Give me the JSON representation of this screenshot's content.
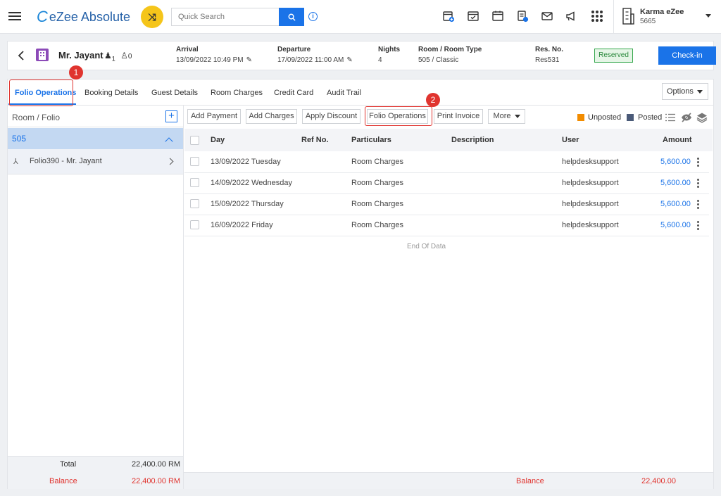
{
  "topbar": {
    "logo_text": "eZee Absolute",
    "search_placeholder": "Quick Search",
    "info_glyph": "i",
    "user_name": "Karma eZee",
    "user_sub": "5665",
    "icons": [
      "calendar-add-icon",
      "calendar-check-icon",
      "calendar-icon",
      "invoice-icon",
      "mail-icon",
      "megaphone-icon",
      "apps-grid-icon",
      "building-icon"
    ]
  },
  "reservation": {
    "guest_name": "Mr. Jayant",
    "adults": "1",
    "children": "0",
    "arrival_label": "Arrival",
    "arrival_value": "13/09/2022 10:49 PM",
    "departure_label": "Departure",
    "departure_value": "17/09/2022 11:00 AM",
    "nights_label": "Nights",
    "nights_value": "4",
    "room_label": "Room / Room Type",
    "room_value": "505 / Classic",
    "resno_label": "Res. No.",
    "resno_value": "Res531",
    "status_badge": "Reserved",
    "checkin_label": "Check-in"
  },
  "tabs": [
    {
      "label": "Folio Operations",
      "active": true
    },
    {
      "label": "Booking Details",
      "active": false
    },
    {
      "label": "Guest Details",
      "active": false
    },
    {
      "label": "Room Charges",
      "active": false
    },
    {
      "label": "Credit Card",
      "active": false
    },
    {
      "label": "Audit Trail",
      "active": false
    }
  ],
  "options_label": "Options",
  "steps": [
    "1",
    "2"
  ],
  "left_panel": {
    "header": "Room / Folio",
    "add_glyph": "+",
    "room": "505",
    "folio": "Folio390 - Mr. Jayant",
    "total_label": "Total",
    "total_value": "22,400.00 RM",
    "balance_label": "Balance",
    "balance_value": "22,400.00 RM"
  },
  "toolbar": {
    "add_payment": "Add Payment",
    "add_charges": "Add Charges",
    "apply_discount": "Apply Discount",
    "folio_operations": "Folio Operations",
    "print_invoice": "Print Invoice",
    "more": "More",
    "legend_unposted": "Unposted",
    "legend_posted": "Posted"
  },
  "table": {
    "columns": [
      "Day",
      "Ref No.",
      "Particulars",
      "Description",
      "User",
      "Amount"
    ],
    "rows": [
      {
        "day": "13/09/2022 Tuesday",
        "ref": "",
        "particulars": "Room Charges",
        "description": "",
        "user": "helpdesksupport",
        "amount": "5,600.00"
      },
      {
        "day": "14/09/2022 Wednesday",
        "ref": "",
        "particulars": "Room Charges",
        "description": "",
        "user": "helpdesksupport",
        "amount": "5,600.00"
      },
      {
        "day": "15/09/2022 Thursday",
        "ref": "",
        "particulars": "Room Charges",
        "description": "",
        "user": "helpdesksupport",
        "amount": "5,600.00"
      },
      {
        "day": "16/09/2022 Friday",
        "ref": "",
        "particulars": "Room Charges",
        "description": "",
        "user": "helpdesksupport",
        "amount": "5,600.00"
      }
    ],
    "end_text": "End Of Data",
    "balance_label": "Balance",
    "balance_value": "22,400.00"
  },
  "colors": {
    "accent": "#1a73e8",
    "unposted": "#f28c00",
    "posted": "#4a5a78",
    "balance": "#e0342f",
    "reserved_green": "#36a74d",
    "highlight": "#e0342f"
  }
}
